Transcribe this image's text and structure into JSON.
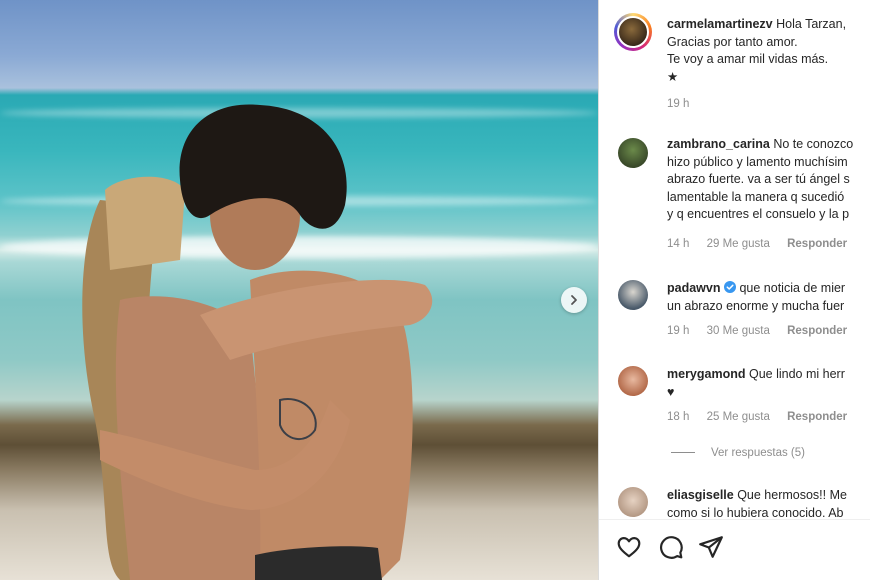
{
  "post": {
    "author": "carmelamartinezv",
    "caption_lines": [
      "Hola Tarzan,",
      "Gracias por tanto amor.",
      "Te voy a amar mil vidas más."
    ],
    "caption_star": "★",
    "time": "19 h"
  },
  "comments": [
    {
      "user": "zambrano_carina",
      "lines": [
        "No te conozco",
        "hizo público y lamento muchísim",
        "abrazo fuerte. va a ser tú ángel s",
        "lamentable la manera q sucedió",
        "y q encuentres el consuelo y la p"
      ],
      "time": "14 h",
      "likes": "29 Me gusta",
      "reply": "Responder"
    },
    {
      "user": "padawvn",
      "verified": true,
      "lines": [
        "que noticia de mier",
        "un abrazo enorme y mucha fuer"
      ],
      "time": "19 h",
      "likes": "30 Me gusta",
      "reply": "Responder"
    },
    {
      "user": "merygamond",
      "lines": [
        "Que lindo mi herr",
        "♥"
      ],
      "time": "18 h",
      "likes": "25 Me gusta",
      "reply": "Responder"
    },
    {
      "user": "eliasgiselle",
      "lines": [
        "Que hermosos!! Me",
        "como si lo hubiera conocido. Ab"
      ]
    }
  ],
  "view_replies": "Ver respuestas (5)",
  "icons": {
    "like": "heart-icon",
    "comment": "comment-bubble-icon",
    "share": "paper-plane-icon",
    "next": "chevron-right-icon",
    "verified": "verified-badge-icon"
  },
  "colors": {
    "verified": "#3897f0",
    "meta": "#8e8e8e",
    "text": "#262626"
  }
}
